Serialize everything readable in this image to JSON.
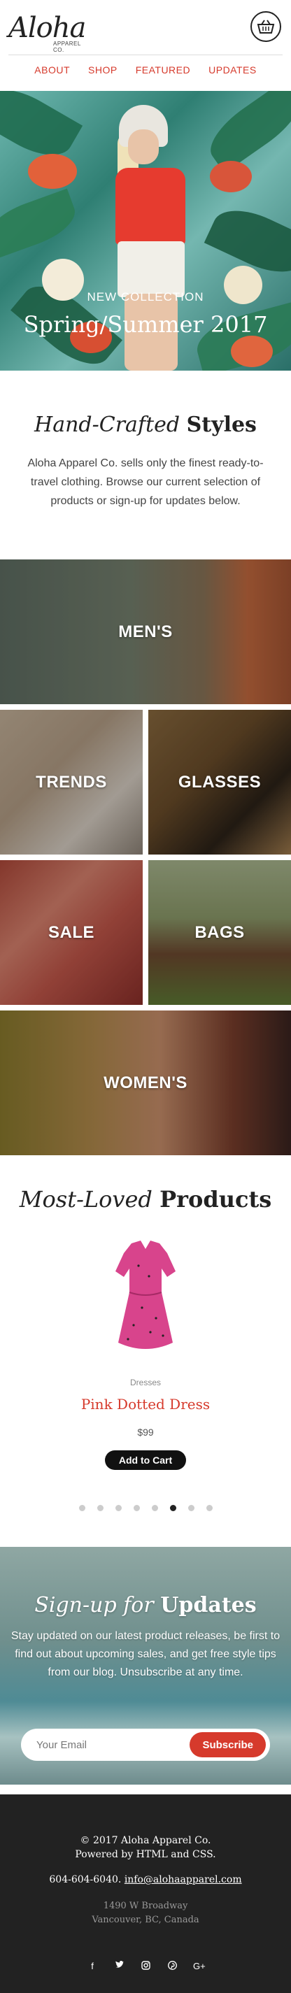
{
  "brand": {
    "name": "Aloha",
    "sub": "APPAREL CO."
  },
  "nav": [
    "ABOUT",
    "SHOP",
    "FEATURED",
    "UPDATES"
  ],
  "hero": {
    "kicker": "NEW COLLECTION",
    "title": "Spring/Summer 2017"
  },
  "intro": {
    "title_italic": "Hand-Crafted",
    "title_bold": "Styles",
    "text": "Aloha Apparel Co. sells only the finest ready-to-travel clothing. Browse our current selection of products or sign-up for updates below."
  },
  "categories": {
    "mens": "MEN'S",
    "trends": "TRENDS",
    "glasses": "GLASSES",
    "sale": "SALE",
    "bags": "BAGS",
    "womens": "WOMEN'S"
  },
  "products": {
    "title_italic": "Most-Loved",
    "title_bold": "Products",
    "item": {
      "category": "Dresses",
      "name": "Pink Dotted Dress",
      "price": "$99",
      "button": "Add to Cart"
    },
    "slides": 8,
    "active_slide": 6
  },
  "signup": {
    "title_italic": "Sign-up for",
    "title_bold": "Updates",
    "text": "Stay updated on our latest product releases, be first to find out about upcoming sales, and get free style tips from our blog. Unsubscribe at any time.",
    "placeholder": "Your Email",
    "button": "Subscribe"
  },
  "footer": {
    "copyright": "© 2017 Aloha Apparel Co.",
    "powered": "Powered by HTML and CSS.",
    "phone": "604-604-6040.",
    "email": "info@alohaapparel.com",
    "address1": "1490 W Broadway",
    "address2": "Vancouver, BC, Canada",
    "social": [
      "facebook-icon",
      "twitter-icon",
      "instagram-icon",
      "pinterest-icon",
      "google-plus-icon"
    ]
  },
  "colors": {
    "accent": "#d63a2c",
    "footer_bg": "#222222"
  }
}
